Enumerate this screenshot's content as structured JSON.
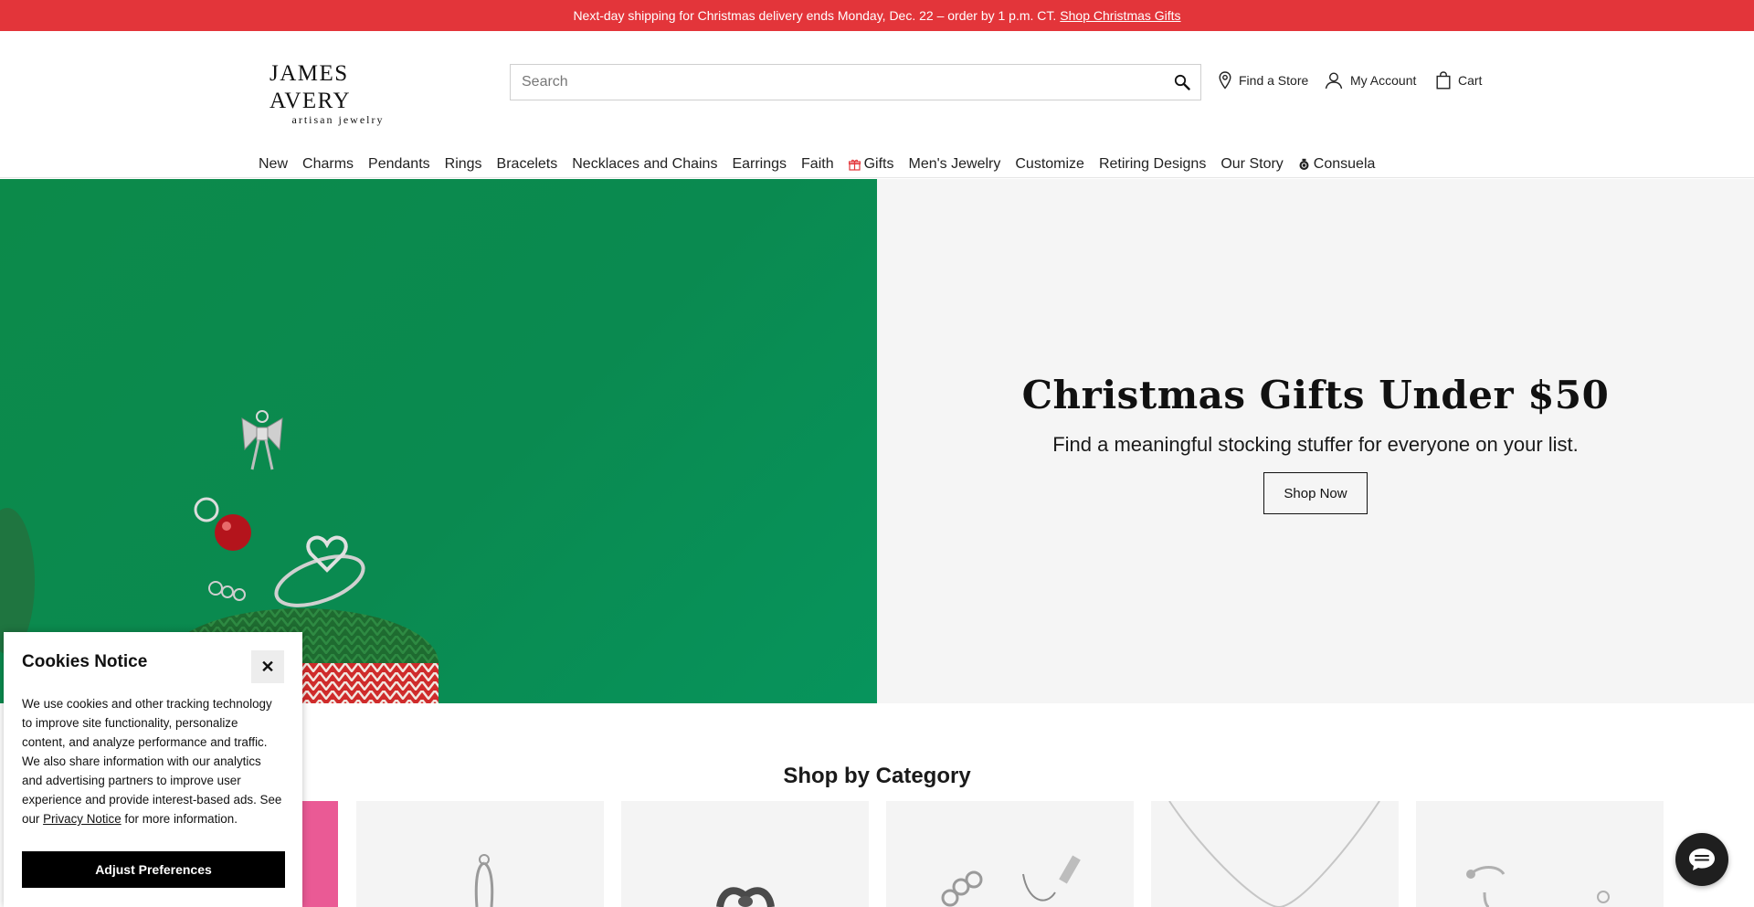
{
  "promo": {
    "text": "Next-day shipping for Christmas delivery ends Monday, Dec. 22 – order by 1 p.m. CT.",
    "link": "Shop Christmas Gifts",
    "background": "#e3353a"
  },
  "header": {
    "logo_top": "JAMES AVERY",
    "logo_sub": "artisan jewelry",
    "search_placeholder": "Search",
    "utilities": {
      "store": "Find a Store",
      "account": "My Account",
      "cart": "Cart"
    },
    "nav": [
      {
        "label": "New"
      },
      {
        "label": "Charms"
      },
      {
        "label": "Pendants"
      },
      {
        "label": "Rings"
      },
      {
        "label": "Bracelets"
      },
      {
        "label": "Necklaces and Chains"
      },
      {
        "label": "Earrings"
      },
      {
        "label": "Faith"
      },
      {
        "label": "Gifts",
        "icon": "gift-icon"
      },
      {
        "label": "Men's Jewelry"
      },
      {
        "label": "Customize"
      },
      {
        "label": "Retiring Designs"
      },
      {
        "label": "Our Story"
      },
      {
        "label": "Consuela",
        "icon": "consuela-icon"
      }
    ]
  },
  "hero": {
    "title": "Christmas Gifts Under $50",
    "subtitle": "Find a meaningful stocking stuffer for everyone on your list.",
    "button": "Shop Now",
    "image_background": "#0a8a50"
  },
  "category": {
    "title": "Shop by Category"
  },
  "cookies": {
    "title": "Cookies Notice",
    "close": "✕",
    "body_before": "We use cookies and other tracking technology to improve site functionality, personalize content, and analyze performance and traffic. We also share information with our analytics and advertising partners to improve user experience and provide interest-based ads. See our ",
    "privacy_link": "Privacy Notice",
    "body_after": " for more information.",
    "button": "Adjust Preferences"
  },
  "chat": {
    "icon": "chat-icon"
  }
}
